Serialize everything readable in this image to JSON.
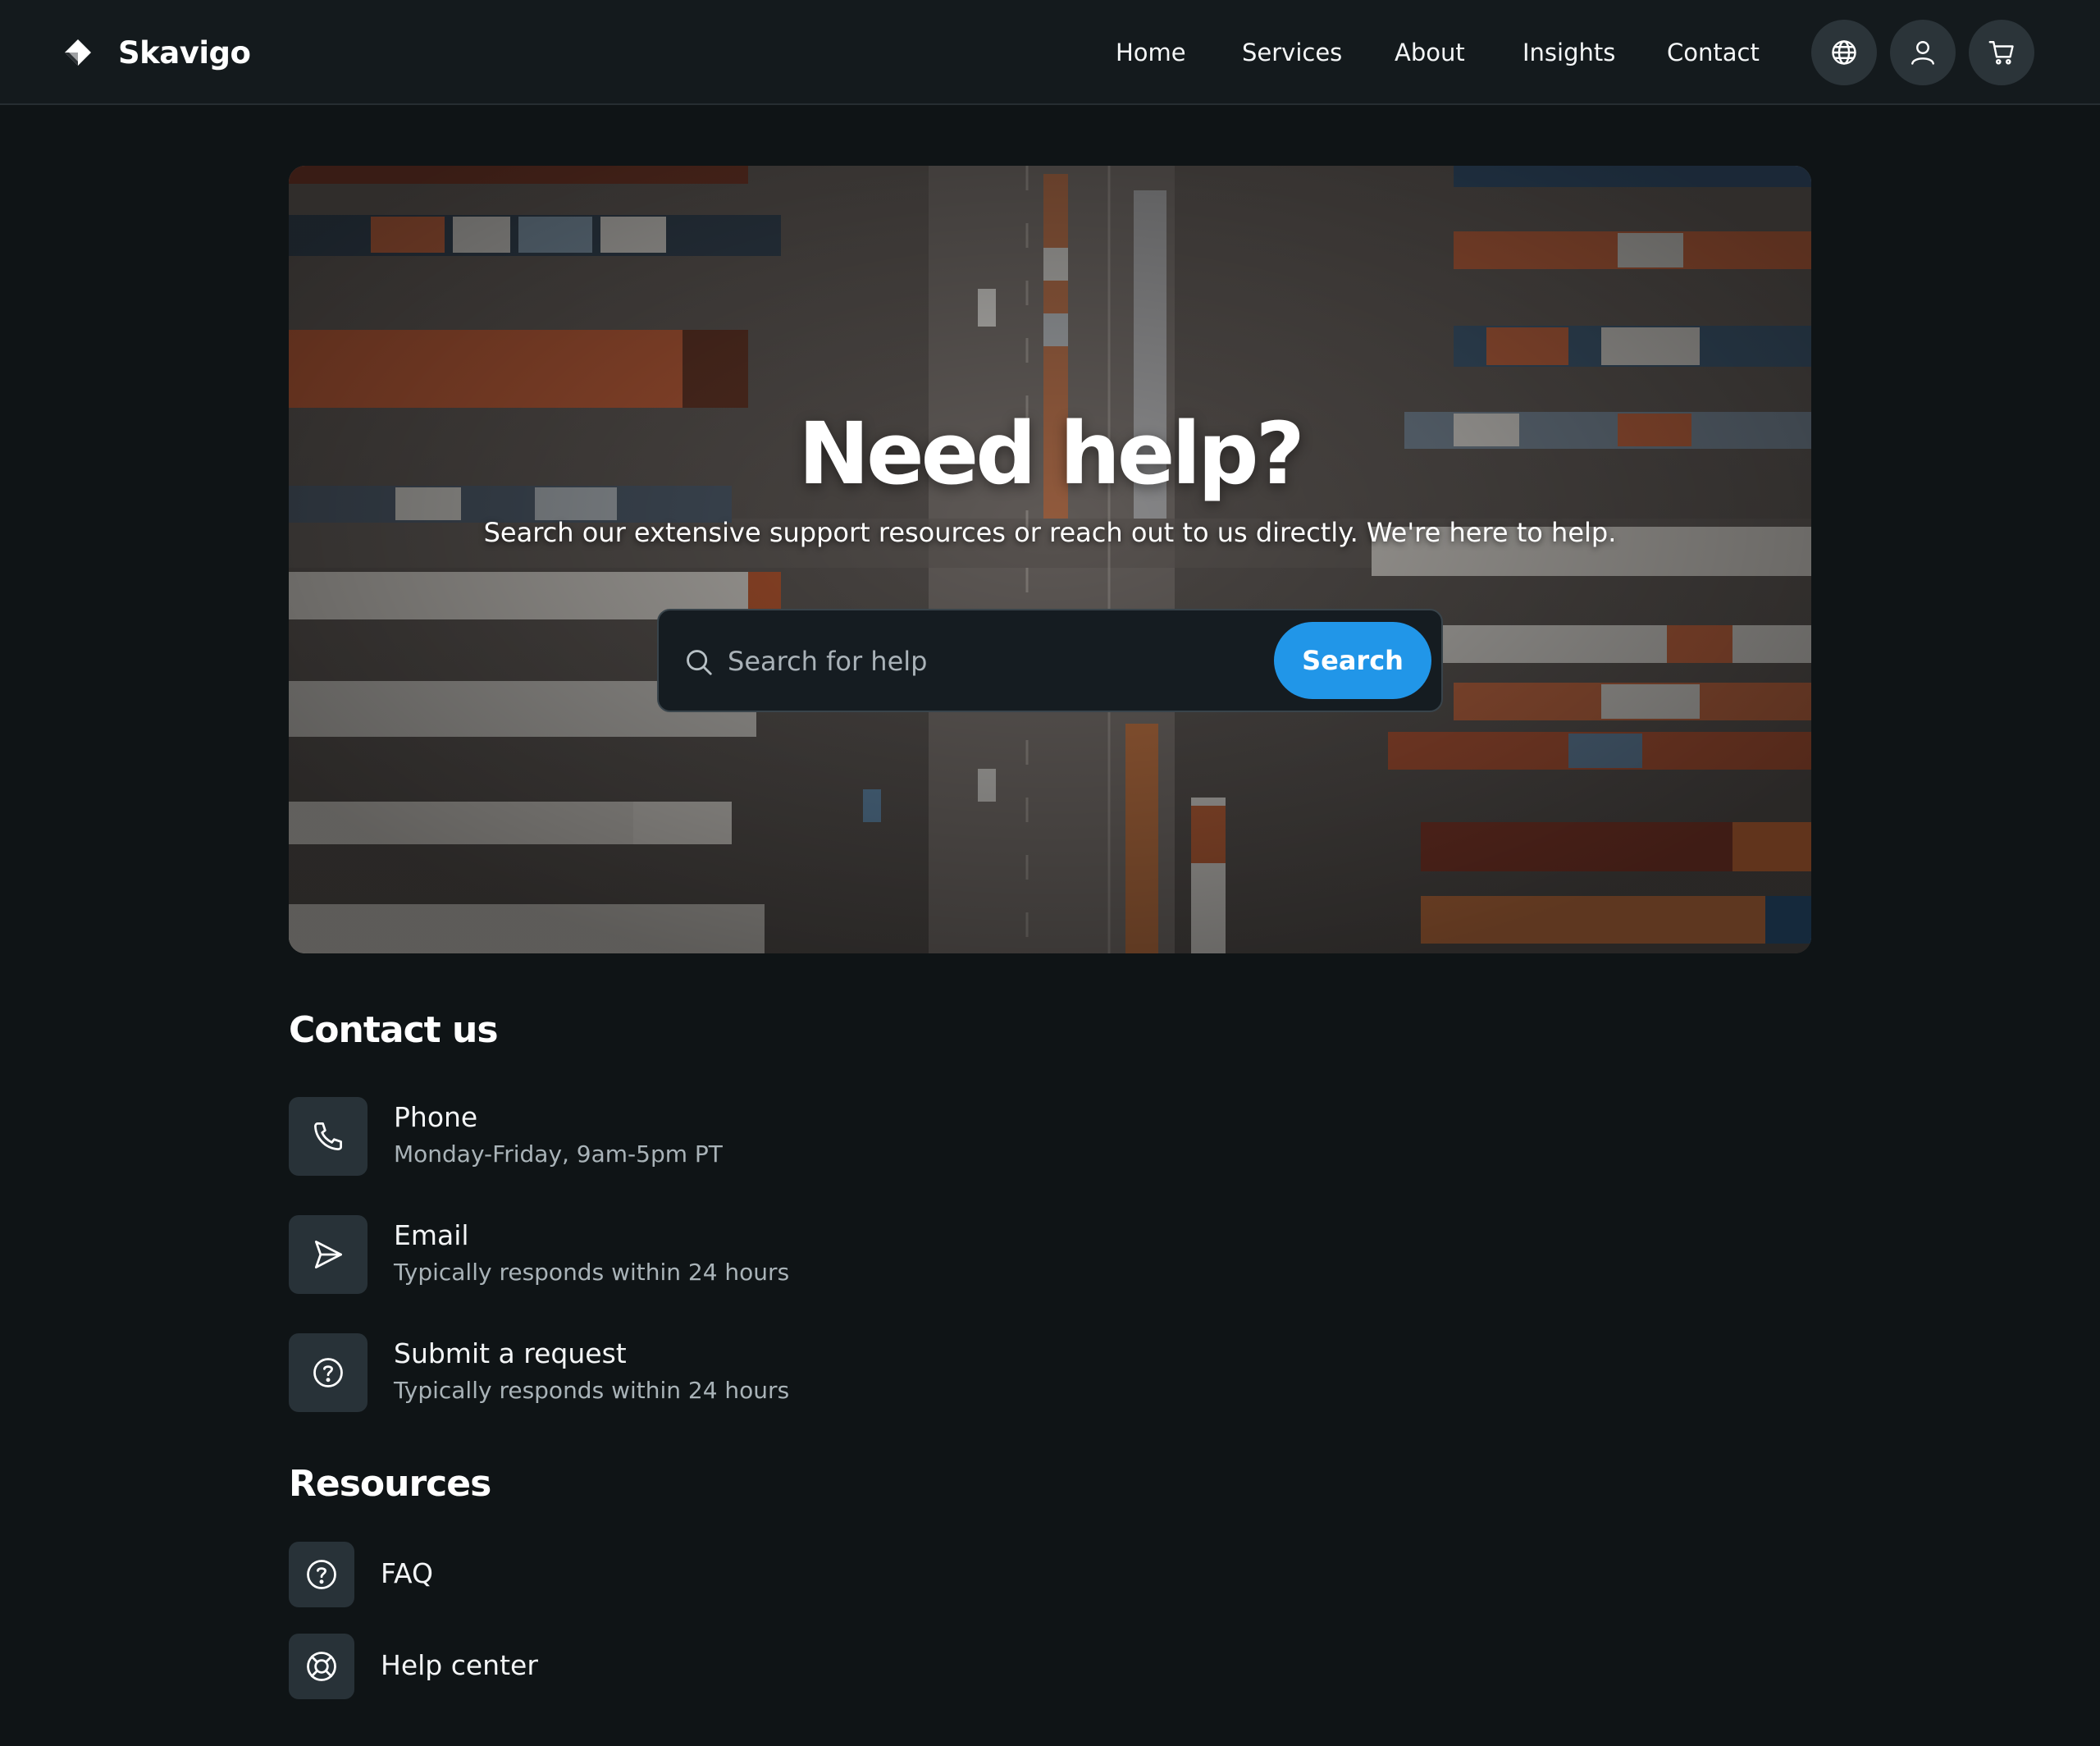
{
  "brand": {
    "name": "Skavigo",
    "icon": "diamond-logo-icon"
  },
  "nav": {
    "links": [
      "Home",
      "Services",
      "About",
      "Insights",
      "Contact"
    ],
    "icons": [
      "globe-icon",
      "user-icon",
      "cart-icon"
    ]
  },
  "hero": {
    "title": "Need help?",
    "subtitle": "Search our extensive support resources or reach out to us directly. We're here to help.",
    "search": {
      "placeholder": "Search for help",
      "button": "Search"
    }
  },
  "contact": {
    "heading": "Contact us",
    "items": [
      {
        "icon": "phone-icon",
        "title": "Phone",
        "subtitle": "Monday-Friday, 9am-5pm PT"
      },
      {
        "icon": "send-icon",
        "title": "Email",
        "subtitle": "Typically responds within 24 hours"
      },
      {
        "icon": "help-circle-icon",
        "title": "Submit a request",
        "subtitle": "Typically responds within 24 hours"
      }
    ]
  },
  "resources": {
    "heading": "Resources",
    "items": [
      {
        "icon": "help-circle-icon",
        "label": "FAQ"
      },
      {
        "icon": "lifebuoy-icon",
        "label": "Help center"
      }
    ]
  },
  "colors": {
    "background": "#0f1416",
    "header": "#141a1d",
    "tile": "#283238",
    "accent": "#2196e8"
  }
}
